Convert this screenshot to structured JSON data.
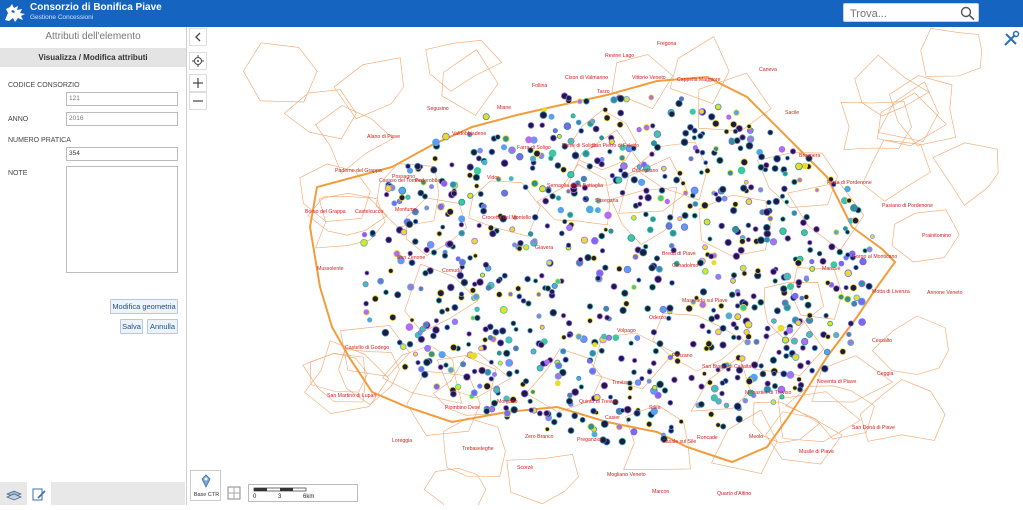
{
  "header": {
    "title": "Consorzio di Bonifica Piave",
    "subtitle": "Gestione Concessioni",
    "search_placeholder": "Trova..."
  },
  "panel": {
    "title": "Attributi dell'elemento",
    "subtitle": "Visualizza / Modifica attributi",
    "fields": {
      "codice_label": "CODICE CONSORZIO",
      "codice_value": "121",
      "anno_label": "ANNO",
      "anno_value": "2016",
      "numero_label": "NUMERO PRATICA",
      "numero_value": "354",
      "note_label": "NOTE"
    },
    "buttons": {
      "modify_geometry": "Modifica geometria",
      "save": "Salva",
      "cancel": "Annulla"
    }
  },
  "map": {
    "base_layer_label": "Base CTR",
    "scale_labels": [
      "0",
      "3",
      "6km"
    ],
    "place_names": [
      "Fregona",
      "Revine Lago",
      "Cison di Valmarino",
      "Vittorio Veneto",
      "Cappella Maggiore",
      "Caneva",
      "Follina",
      "Tarzo",
      "Segusino",
      "Miane",
      "Sacile",
      "Valdobbiadene",
      "Alano di Piave",
      "Pieve di Soligo",
      "Farra di Soligo",
      "San Pietro di Feletto",
      "Conegliano",
      "Brugnera",
      "Paderno del Grappa",
      "Possagno",
      "Cavaso del Tomba",
      "Pederobba",
      "Sernaglia della Battaglia",
      "Prata di Pordenone",
      "Borso del Grappa",
      "Castelcucco",
      "Monfumo",
      "Crocetta del Montello",
      "Susegana",
      "Pasiano di Pordenone",
      "Prainitomino",
      "San Zenone",
      "Cornuda",
      "Giavera",
      "Mansuè",
      "Gorgo al Monticano",
      "Mussolente",
      "Cimadolmo",
      "Motta di Livenza",
      "Annone Veneto",
      "Maserada sul Piave",
      "Cessalto",
      "Volpago",
      "Oderzo",
      "Castello di Godego",
      "Ceggia",
      "San Biagio di Callalta",
      "San Martino di Lupari",
      "Noventa di Piave",
      "Ponzano",
      "Treviso",
      "Monastier di Treviso",
      "Piombino Dese",
      "Morgano",
      "Quinto di Treviso",
      "Silea",
      "San Donà di Piave",
      "Casier",
      "Loreggia",
      "Zero Branco",
      "Preganziol",
      "Roncade",
      "Meolo",
      "Casale sul Sile",
      "Musile di Piave",
      "Trebaseleghe",
      "Scorzè",
      "Mogliano Veneto",
      "Marcon",
      "Quarto d'Altino",
      "Vidor",
      "Breda di Piave"
    ]
  },
  "colors": {
    "header_bg": "#1565c0",
    "boundary_outer": "#f39c3c",
    "boundary_municipal": "#f4a46a",
    "place_label": "#d32020",
    "point_dark": "#1f1a45",
    "point_colors": [
      "#7b68ee",
      "#3cc9a0",
      "#e7dd2a",
      "#5aa0f0",
      "#b26cf0",
      "#2f8f9d"
    ]
  },
  "icons": {
    "logo": "lion-logo-icon",
    "search": "search-icon",
    "back": "chevron-left-icon",
    "locate": "locate-icon",
    "zoom_in": "plus-icon",
    "zoom_out": "minus-icon",
    "settings": "tools-icon",
    "layers": "layers-icon",
    "edit": "edit-icon",
    "base_layer": "map-layer-icon",
    "map_tool": "map-grid-icon"
  }
}
